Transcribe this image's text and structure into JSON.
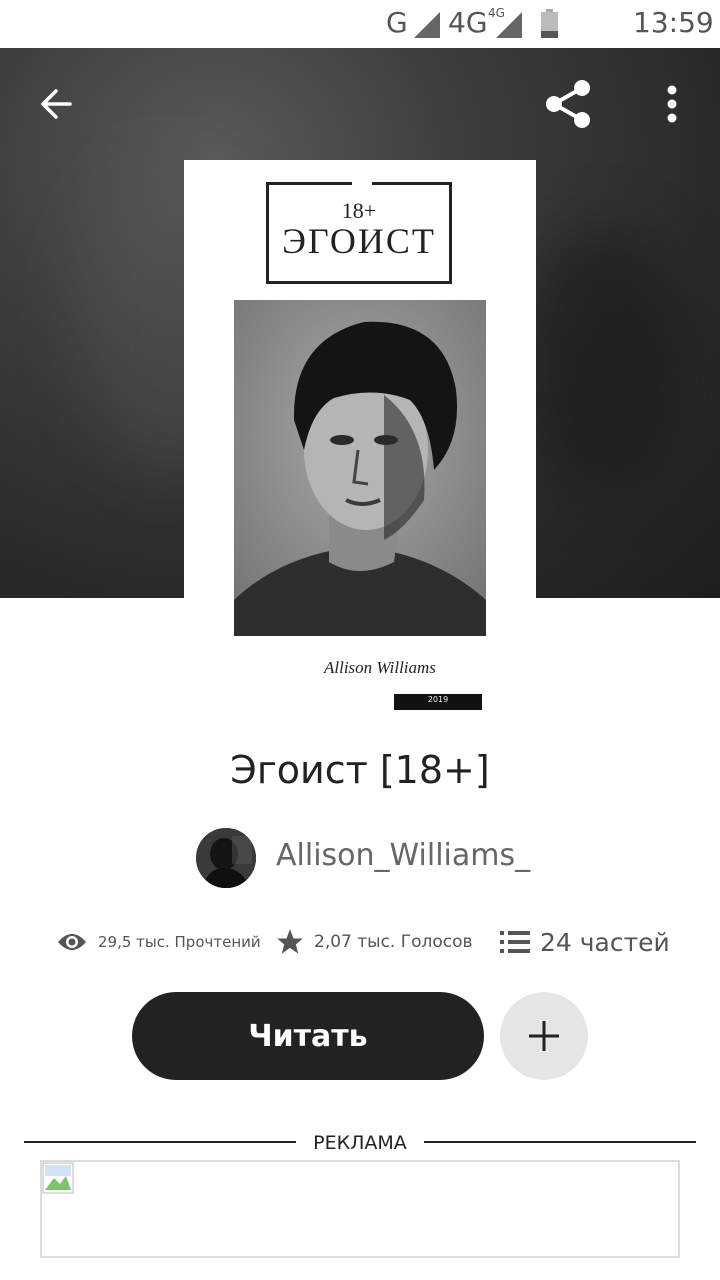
{
  "status_bar": {
    "network_g": "G",
    "network_4g": "4G",
    "network_4g_small": "4G",
    "time": "13:59"
  },
  "toolbar": {
    "back_icon": "arrow-left-icon",
    "share_icon": "share-icon",
    "more_icon": "more-vertical-icon"
  },
  "cover": {
    "age_rating": "18+",
    "title": "ЭГОИСТ",
    "author_signature": "Allison Williams",
    "year": "2019"
  },
  "story": {
    "title": "Эгоист [18+]",
    "author": "Allison_Williams_"
  },
  "stats": {
    "reads": "29,5 тыс. Прочтений",
    "votes": "2,07 тыс. Голосов",
    "parts": "24 частей"
  },
  "actions": {
    "read_label": "Читать",
    "add_icon": "plus-icon"
  },
  "ad": {
    "label": "РЕКЛАМА"
  },
  "colors": {
    "primary_button": "#222222",
    "secondary_button": "#e6e6e6",
    "text_muted": "#666666"
  }
}
